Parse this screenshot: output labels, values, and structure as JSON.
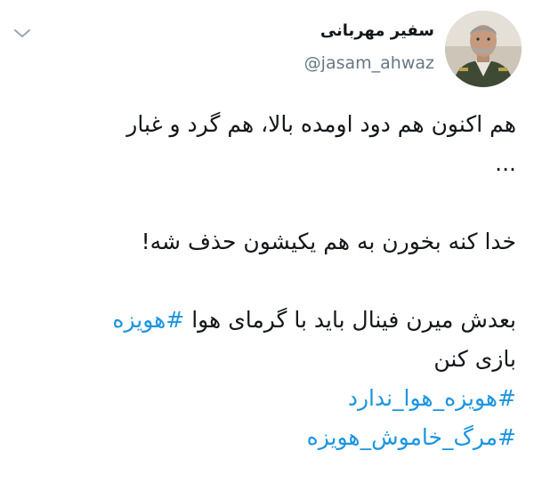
{
  "user": {
    "display_name": "سفیر مهربانی",
    "handle": "@jasam_ahwaz"
  },
  "icons": {
    "menu": "chevron-down-icon",
    "avatar": "avatar"
  },
  "colors": {
    "hashtag": "#1b95e0",
    "handle": "#657786",
    "text": "#14171a"
  },
  "tweet": {
    "line1": "هم اکنون هم دود اومده بالا، هم گرد و غبار",
    "line2": "...",
    "line3": "خدا کنه بخورن به هم یکیشون حذف شه!",
    "line4_text": "بعدش میرن فینال باید با گرمای هوا ",
    "line4_hashtag": "#هویزه",
    "line5": "بازی کنن",
    "hashtag1": "#هویزه_هوا_ندارد",
    "hashtag2": "#مرگ_خاموش_هویزه"
  }
}
